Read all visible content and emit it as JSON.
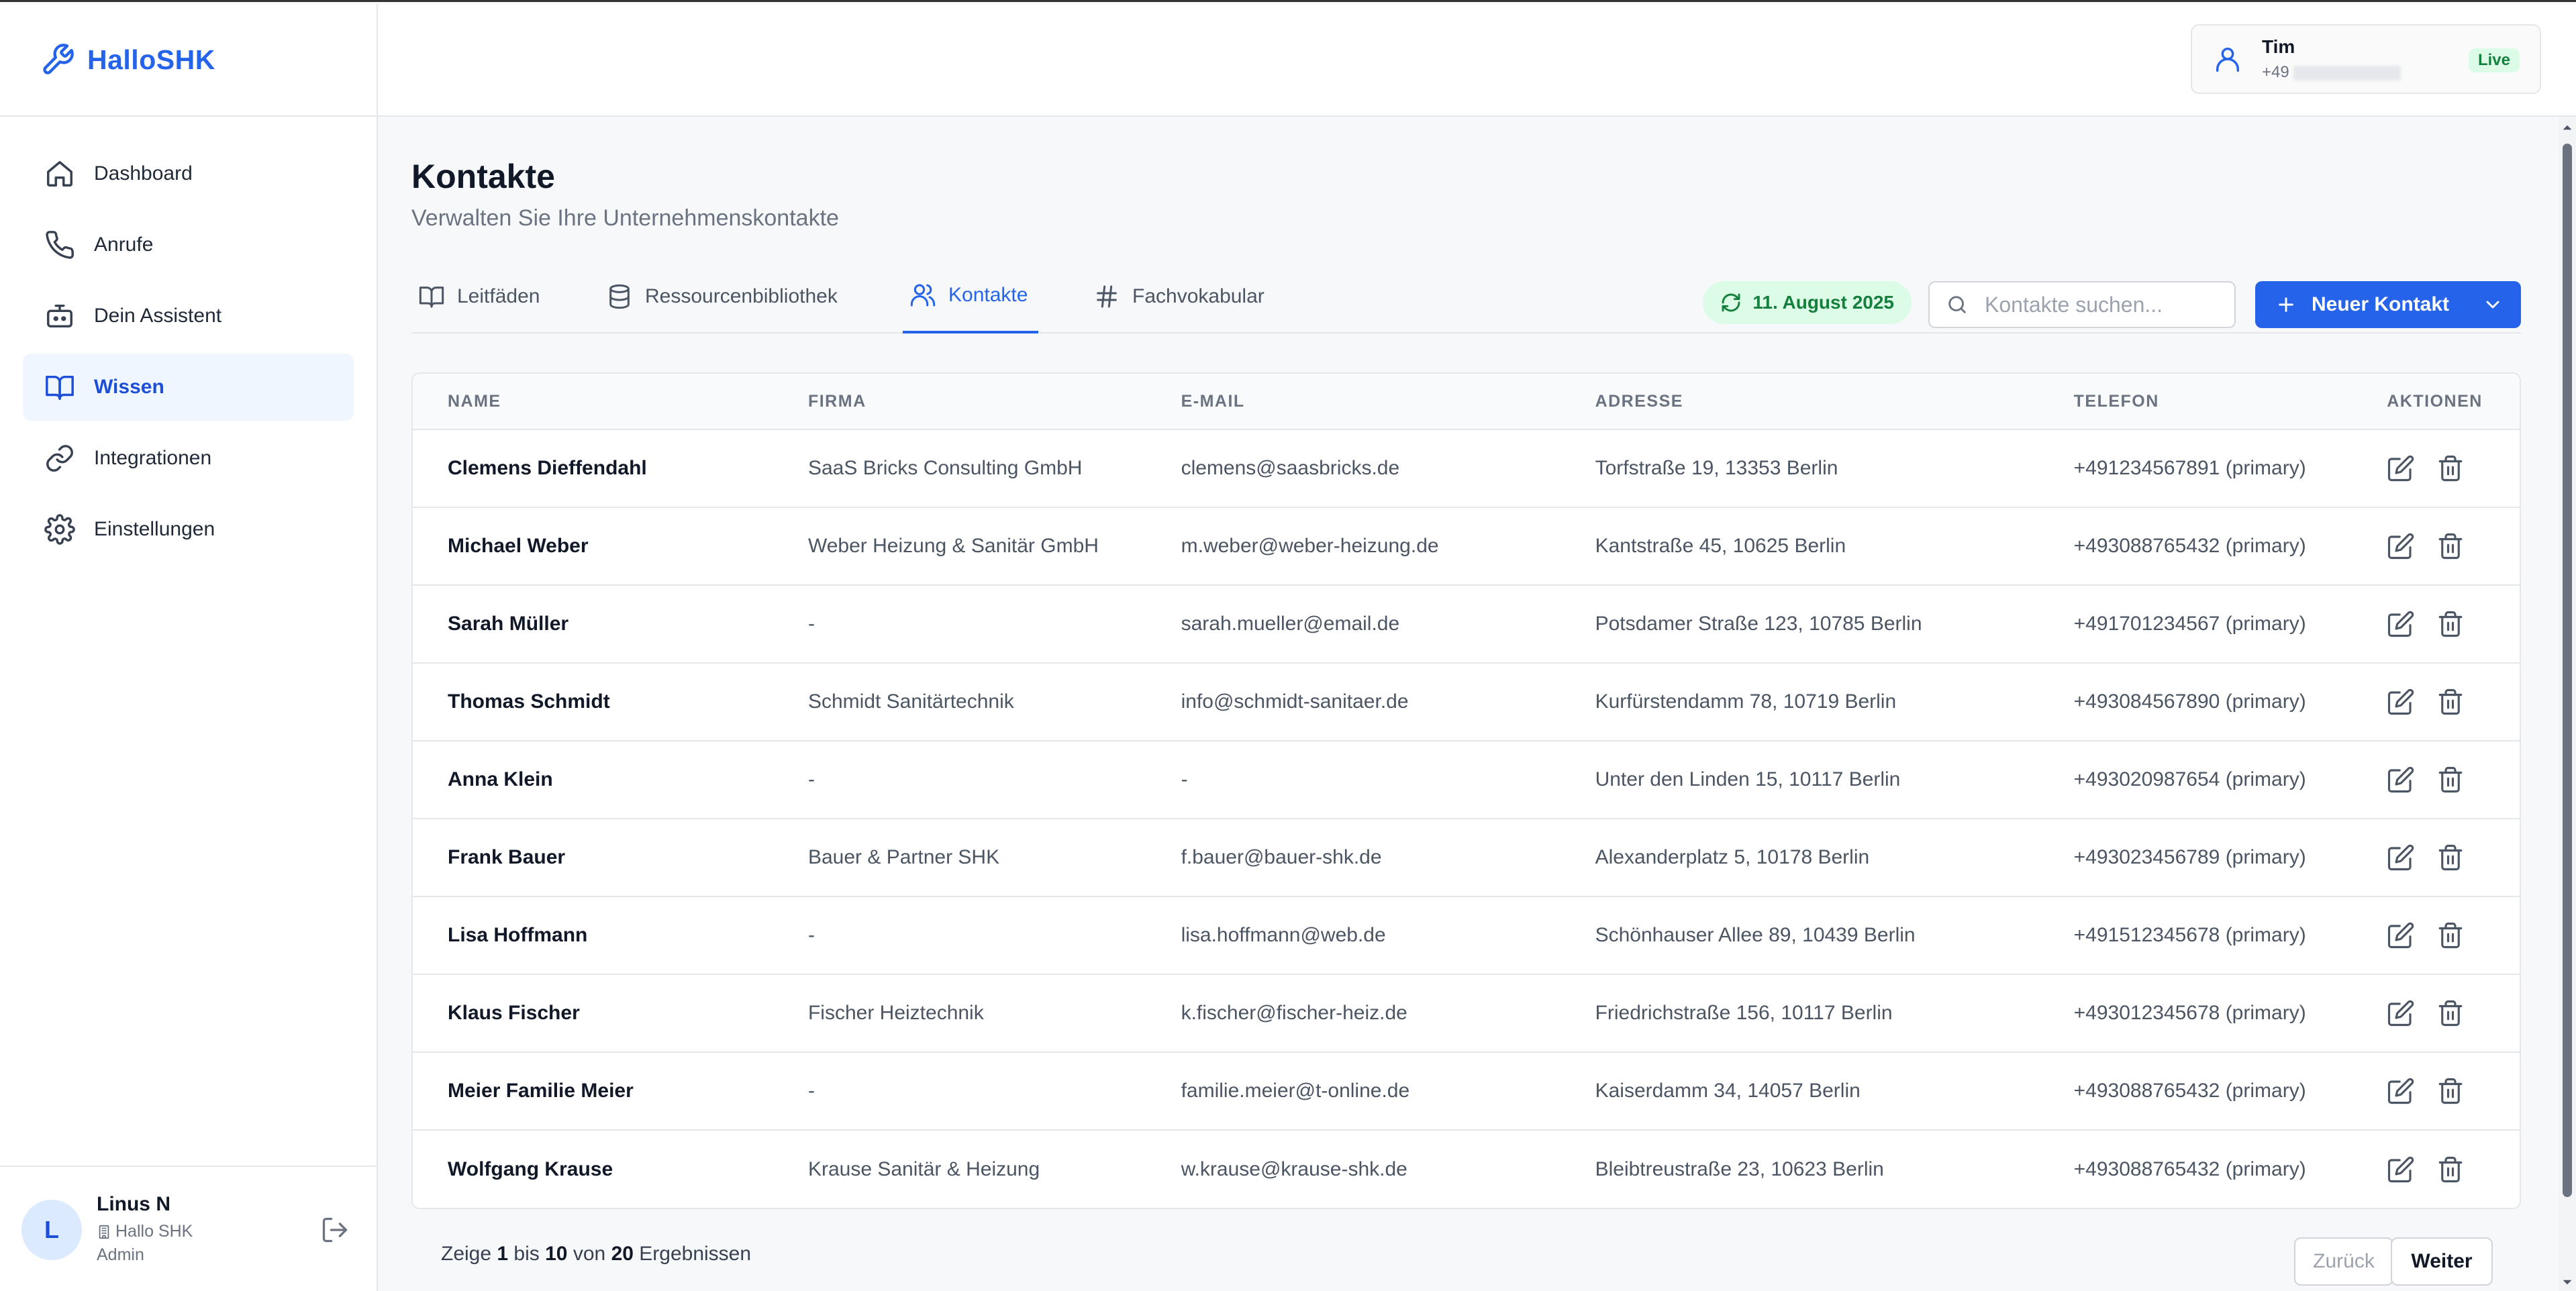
{
  "app": {
    "name": "HalloSHK",
    "brand_color": "#2563eb"
  },
  "sidebar": {
    "items": [
      {
        "label": "Dashboard",
        "icon": "home-icon"
      },
      {
        "label": "Anrufe",
        "icon": "phone-icon"
      },
      {
        "label": "Dein Assistent",
        "icon": "bot-icon"
      },
      {
        "label": "Wissen",
        "icon": "book-icon",
        "active": true
      },
      {
        "label": "Integrationen",
        "icon": "link-icon"
      },
      {
        "label": "Einstellungen",
        "icon": "gear-icon"
      }
    ]
  },
  "user": {
    "initial": "L",
    "name": "Linus N",
    "company": "Hallo SHK",
    "role": "Admin"
  },
  "header": {
    "assistant_name": "Tim",
    "phone_prefix": "+49",
    "status": "Live",
    "status_color": "#15803d"
  },
  "page": {
    "title": "Kontakte",
    "subtitle": "Verwalten Sie Ihre Unternehmenskontakte"
  },
  "tabs": [
    {
      "label": "Leitfäden",
      "icon": "book-open-icon"
    },
    {
      "label": "Ressourcenbibliothek",
      "icon": "database-icon"
    },
    {
      "label": "Kontakte",
      "icon": "users-icon",
      "active": true
    },
    {
      "label": "Fachvokabular",
      "icon": "hash-icon"
    }
  ],
  "toolbar": {
    "sync_date": "11. August 2025",
    "search_placeholder": "Kontakte suchen...",
    "new_button_label": "Neuer Kontakt"
  },
  "table": {
    "columns": [
      "NAME",
      "FIRMA",
      "E-MAIL",
      "ADRESSE",
      "TELEFON",
      "AKTIONEN"
    ],
    "rows": [
      {
        "name": "Clemens Dieffendahl",
        "company": "SaaS Bricks Consulting GmbH",
        "email": "clemens@saasbricks.de",
        "address": "Torfstraße 19, 13353 Berlin",
        "phone": "+491234567891 (primary)"
      },
      {
        "name": "Michael Weber",
        "company": "Weber Heizung & Sanitär GmbH",
        "email": "m.weber@weber-heizung.de",
        "address": "Kantstraße 45, 10625 Berlin",
        "phone": "+493088765432 (primary)"
      },
      {
        "name": "Sarah Müller",
        "company": "-",
        "email": "sarah.mueller@email.de",
        "address": "Potsdamer Straße 123, 10785 Berlin",
        "phone": "+491701234567 (primary)"
      },
      {
        "name": "Thomas Schmidt",
        "company": "Schmidt Sanitärtechnik",
        "email": "info@schmidt-sanitaer.de",
        "address": "Kurfürstendamm 78, 10719 Berlin",
        "phone": "+493084567890 (primary)"
      },
      {
        "name": "Anna Klein",
        "company": "-",
        "email": "-",
        "address": "Unter den Linden 15, 10117 Berlin",
        "phone": "+493020987654 (primary)"
      },
      {
        "name": "Frank Bauer",
        "company": "Bauer & Partner SHK",
        "email": "f.bauer@bauer-shk.de",
        "address": "Alexanderplatz 5, 10178 Berlin",
        "phone": "+493023456789 (primary)"
      },
      {
        "name": "Lisa Hoffmann",
        "company": "-",
        "email": "lisa.hoffmann@web.de",
        "address": "Schönhauser Allee 89, 10439 Berlin",
        "phone": "+491512345678 (primary)"
      },
      {
        "name": "Klaus Fischer",
        "company": "Fischer Heiztechnik",
        "email": "k.fischer@fischer-heiz.de",
        "address": "Friedrichstraße 156, 10117 Berlin",
        "phone": "+493012345678 (primary)"
      },
      {
        "name": "Meier Familie Meier",
        "company": "-",
        "email": "familie.meier@t-online.de",
        "address": "Kaiserdamm 34, 14057 Berlin",
        "phone": "+493088765432 (primary)"
      },
      {
        "name": "Wolfgang Krause",
        "company": "Krause Sanitär & Heizung",
        "email": "w.krause@krause-shk.de",
        "address": "Bleibtreustraße 23, 10623 Berlin",
        "phone": "+493088765432 (primary)"
      }
    ]
  },
  "pagination": {
    "prefix": "Zeige",
    "from": "1",
    "to_word": "bis",
    "to": "10",
    "of_word": "von",
    "total": "20",
    "suffix": "Ergebnissen",
    "prev_label": "Zurück",
    "next_label": "Weiter"
  }
}
